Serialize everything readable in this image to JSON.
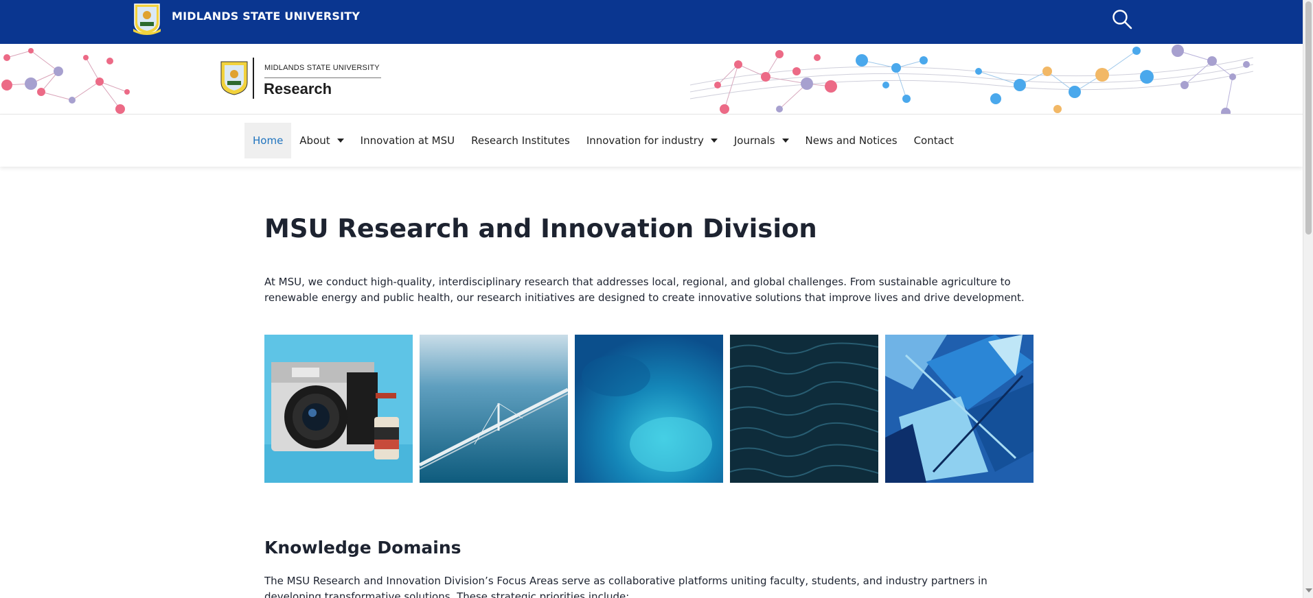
{
  "topbar": {
    "title": "MIDLANDS STATE UNIVERSITY",
    "search_icon": "search-icon"
  },
  "site_logo": {
    "university": "MIDLANDS STATE UNIVERSITY",
    "unit": "Research"
  },
  "nav": {
    "items": [
      {
        "label": "Home",
        "active": true,
        "dropdown": false
      },
      {
        "label": "About",
        "active": false,
        "dropdown": true
      },
      {
        "label": "Innovation at MSU",
        "active": false,
        "dropdown": false
      },
      {
        "label": "Research Institutes",
        "active": false,
        "dropdown": false
      },
      {
        "label": "Innovation for industry",
        "active": false,
        "dropdown": true
      },
      {
        "label": "Journals",
        "active": false,
        "dropdown": true
      },
      {
        "label": "News and Notices",
        "active": false,
        "dropdown": false
      },
      {
        "label": "Contact",
        "active": false,
        "dropdown": false
      }
    ]
  },
  "main": {
    "title": "MSU Research and Innovation Division",
    "intro": "At MSU, we conduct high-quality, interdisciplinary research that addresses local, regional, and global challenges. From sustainable agriculture to renewable energy and public health, our research initiatives are designed to create innovative solutions that improve lives and drive development.",
    "gallery": [
      "camera-photo",
      "bridge-photo",
      "turquoise-water-photo",
      "dark-ocean-photo",
      "blue-abstract-photo"
    ],
    "section_title": "Knowledge Domains",
    "section_text": "The MSU Research and Innovation Division’s Focus Areas serve as collaborative platforms uniting faculty, students, and industry partners in developing transformative solutions. These strategic priorities include:"
  },
  "colors": {
    "brand_blue": "#0a3690",
    "active_link": "#1e73be",
    "heading": "#1d2330"
  }
}
